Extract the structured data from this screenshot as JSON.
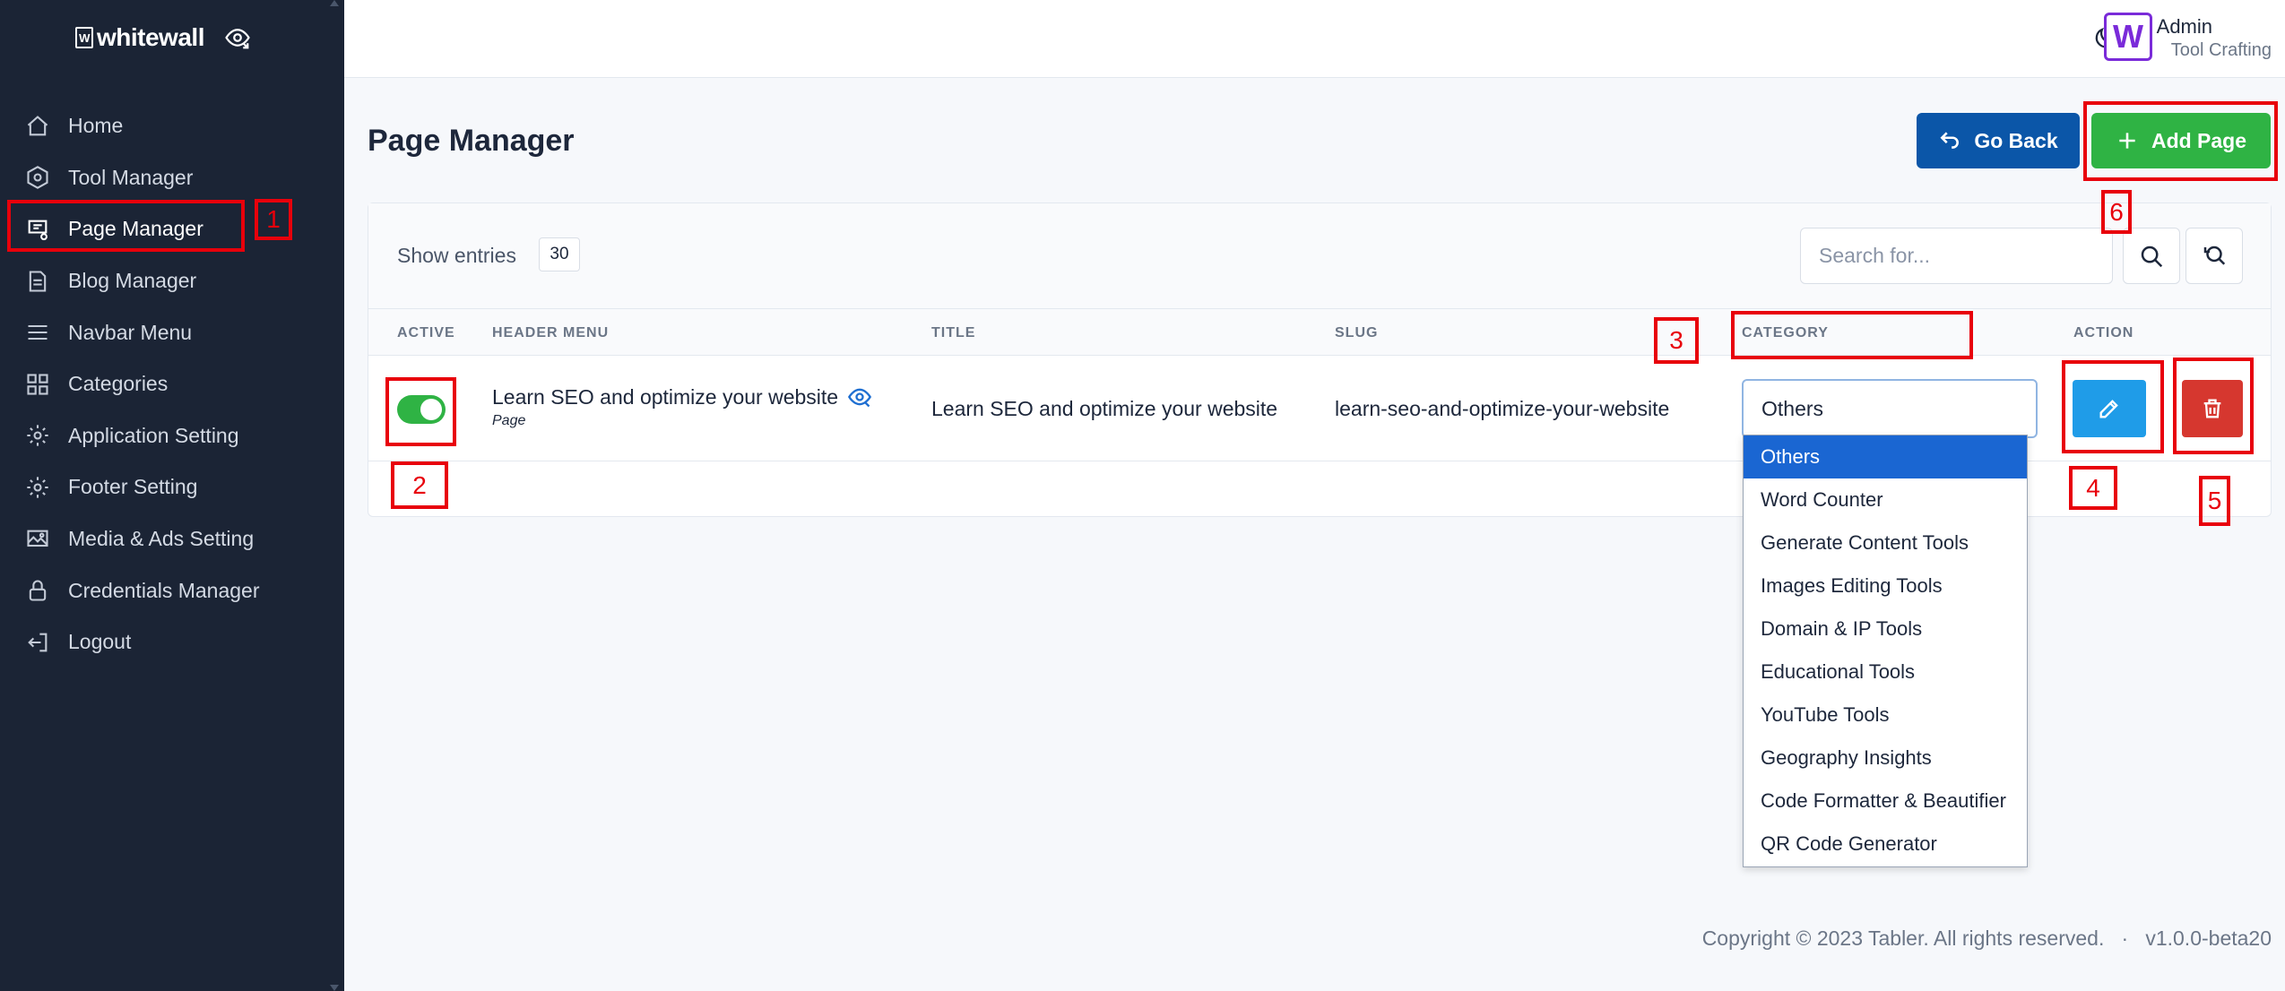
{
  "sidebar": {
    "brand": "whitewall",
    "brand_mark": "W",
    "items": [
      {
        "label": "Home",
        "icon": "home-icon"
      },
      {
        "label": "Tool Manager",
        "icon": "hexagon-icon"
      },
      {
        "label": "Page Manager",
        "icon": "page-settings-icon"
      },
      {
        "label": "Blog Manager",
        "icon": "blog-icon"
      },
      {
        "label": "Navbar Menu",
        "icon": "menu-icon"
      },
      {
        "label": "Categories",
        "icon": "grid-icon"
      },
      {
        "label": "Application Setting",
        "icon": "gear-icon"
      },
      {
        "label": "Footer Setting",
        "icon": "gear-icon"
      },
      {
        "label": "Media & Ads Setting",
        "icon": "image-settings-icon"
      },
      {
        "label": "Credentials Manager",
        "icon": "lock-icon"
      },
      {
        "label": "Logout",
        "icon": "logout-icon"
      }
    ]
  },
  "header": {
    "user_name": "Admin",
    "user_role": "Tool Crafting",
    "avatar_letter": "W"
  },
  "page": {
    "title": "Page Manager",
    "go_back_label": "Go Back",
    "add_page_label": "Add Page"
  },
  "table": {
    "show_entries_label": "Show entries",
    "entries_value": "30",
    "search_placeholder": "Search for...",
    "columns": [
      "ACTIVE",
      "HEADER MENU",
      "TITLE",
      "SLUG",
      "CATEGORY",
      "ACTION"
    ],
    "rows": [
      {
        "active": true,
        "header_menu": "Learn SEO and optimize your website",
        "header_menu_sub": "Page",
        "title": "Learn SEO and optimize your website",
        "slug": "learn-seo-and-optimize-your-website",
        "category": "Others"
      }
    ]
  },
  "dropdown": {
    "options": [
      "Others",
      "Word Counter",
      "Generate Content Tools",
      "Images Editing Tools",
      "Domain & IP Tools",
      "Educational Tools",
      "YouTube Tools",
      "Geography Insights",
      "Code Formatter & Beautifier",
      "QR Code Generator"
    ]
  },
  "annotations": [
    "1",
    "2",
    "3",
    "4",
    "5",
    "6"
  ],
  "footer": {
    "text": "Copyright © 2023 Tabler. All rights reserved.   ·   v1.0.0-beta20"
  },
  "colors": {
    "sidebar_bg": "#1b2435",
    "primary": "#0b56a8",
    "success": "#2fb344",
    "info": "#1f9ce8",
    "danger": "#d6372f",
    "annotation": "#e8000b"
  }
}
